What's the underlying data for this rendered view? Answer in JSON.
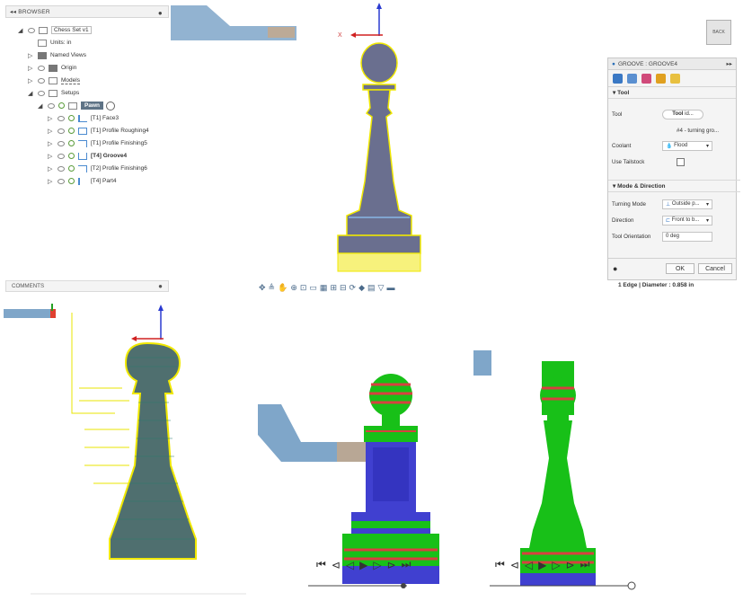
{
  "browser": {
    "title": "BROWSER",
    "root": "Chess Set v1",
    "items": [
      {
        "label": "Units: in"
      },
      {
        "label": "Named Views"
      },
      {
        "label": "Origin"
      },
      {
        "label": "Models"
      },
      {
        "label": "Setups"
      }
    ],
    "setup": "Pawn",
    "ops": [
      {
        "label": "[T1] Face3",
        "bold": false
      },
      {
        "label": "[T1] Profile Roughing4",
        "bold": false
      },
      {
        "label": "[T1] Profile Finishing5",
        "bold": false
      },
      {
        "label": "[T4] Groove4",
        "bold": true
      },
      {
        "label": "[T2] Profile Finishing6",
        "bold": false
      },
      {
        "label": "[T4] Part4",
        "bold": false
      }
    ]
  },
  "viewcube": {
    "label": "BACK"
  },
  "axis": {
    "x": "X"
  },
  "dialog": {
    "title": "GROOVE : GROOVE4",
    "tool_section": "Tool",
    "tool_label": "Tool",
    "tool_button": "Tool",
    "tool_button_suffix": "id...",
    "tool_desc": "#4 - turning gro...",
    "coolant_label": "Coolant",
    "coolant_value": "Flood",
    "tailstock_label": "Use Tailstock",
    "mode_section": "Mode & Direction",
    "turning_mode_label": "Turning Mode",
    "turning_mode_value": "Outside p...",
    "direction_label": "Direction",
    "direction_value": "Front to b...",
    "orientation_label": "Tool Orientation",
    "orientation_value": "0 deg",
    "ok": "OK",
    "cancel": "Cancel"
  },
  "comments": {
    "title": "COMMENTS"
  },
  "status": {
    "text": "1 Edge | Diameter : 0.858 in"
  },
  "colors": {
    "pawn": "#6a6f8f",
    "highlight": "#f4f000",
    "stock": "#4040d0",
    "green": "#18c018",
    "red": "#d84040"
  }
}
